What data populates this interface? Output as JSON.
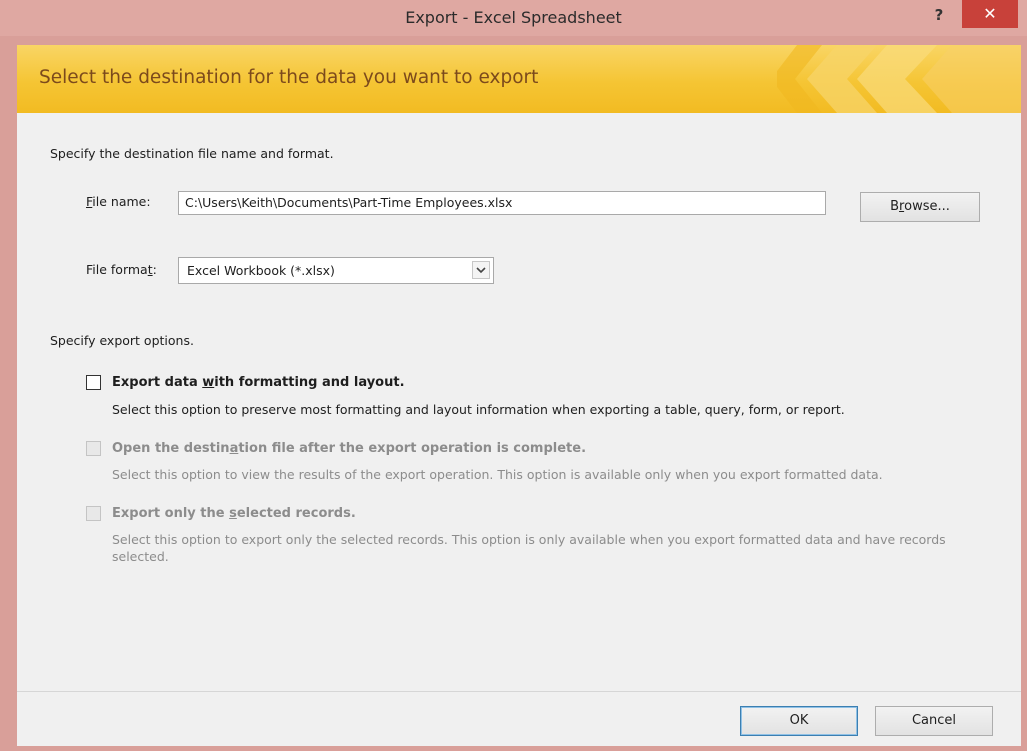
{
  "window": {
    "title": "Export - Excel Spreadsheet",
    "help_label": "?",
    "close_label": "✕"
  },
  "banner": {
    "title": "Select the destination for the data you want to export"
  },
  "file_section": {
    "heading": "Specify the destination file name and format.",
    "file_name_label_prefix": "",
    "file_name_label_mnemonic": "F",
    "file_name_label_rest": "ile name:",
    "file_name_value": "C:\\Users\\Keith\\Documents\\Part-Time Employees.xlsx",
    "browse_label_prefix": "B",
    "browse_label_mnemonic": "r",
    "browse_label_rest": "owse...",
    "file_format_label_prefix": "File forma",
    "file_format_label_mnemonic": "t",
    "file_format_label_rest": ":",
    "file_format_value": "Excel Workbook (*.xlsx)"
  },
  "options_section": {
    "heading": "Specify export options.",
    "options": [
      {
        "title_prefix": "Export data ",
        "title_mnemonic": "w",
        "title_rest": "ith formatting and layout.",
        "description": "Select this option to preserve most formatting and layout information when exporting a table, query, form, or report.",
        "checked": false,
        "enabled": true
      },
      {
        "title_prefix": "Open the destin",
        "title_mnemonic": "a",
        "title_rest": "tion file after the export operation is complete.",
        "description": "Select this option to view the results of the export operation. This option is available only when you export formatted data.",
        "checked": false,
        "enabled": false
      },
      {
        "title_prefix": "Export only the ",
        "title_mnemonic": "s",
        "title_rest": "elected records.",
        "description": "Select this option to export only the selected records. This option is only available when you export formatted data and have records selected.",
        "checked": false,
        "enabled": false
      }
    ]
  },
  "footer": {
    "ok_label": "OK",
    "cancel_label": "Cancel"
  },
  "colors": {
    "banner_title": "#7c4a1c",
    "banner_bg": "#f5c534",
    "close_button": "#c8413a",
    "window_border": "#d99f99"
  }
}
